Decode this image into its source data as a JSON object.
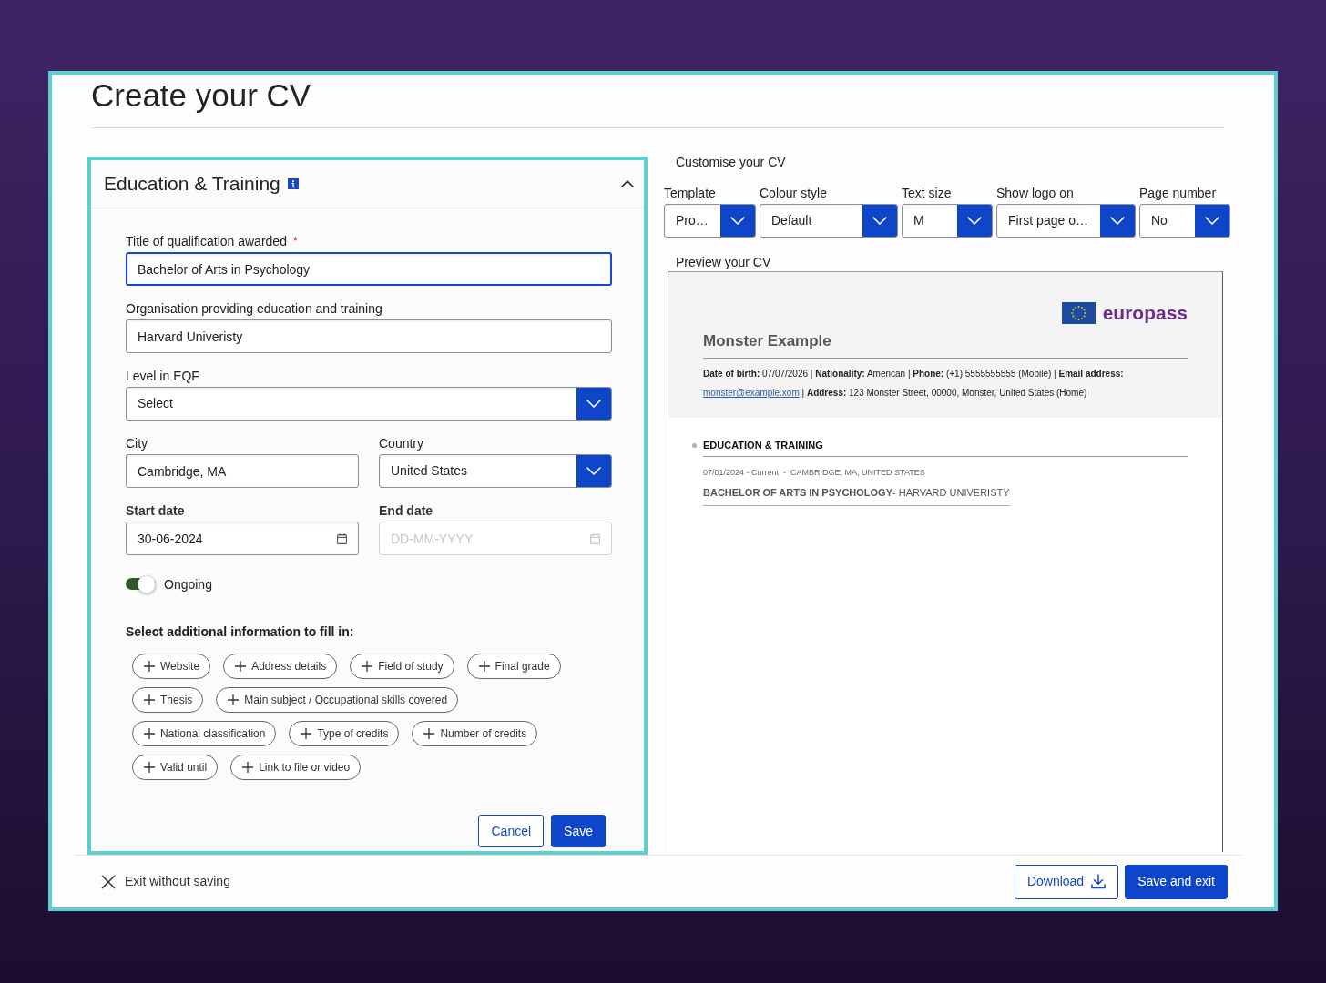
{
  "page": {
    "title": "Create your CV"
  },
  "editor": {
    "title": "Education & Training",
    "expanded": true,
    "rows": [
      [
        {
          "kind": "text",
          "label": "Title of qualification awarded",
          "required_mark": "*",
          "value": "Bachelor of Arts in Psychology",
          "focused": true
        }
      ],
      [
        {
          "kind": "text",
          "label": "Organisation providing education and training",
          "value": "Harvard Univeristy",
          "focused": false
        }
      ],
      [
        {
          "kind": "select",
          "label": "Level in EQF",
          "value": "Select"
        }
      ],
      [
        {
          "kind": "text",
          "label": "City",
          "value": "Cambridge, MA",
          "focused": false
        },
        {
          "kind": "select",
          "label": "Country",
          "value": "United States"
        }
      ],
      [
        {
          "kind": "date",
          "label": "Start date",
          "value": "30-06-2024",
          "disabled": false
        },
        {
          "kind": "date",
          "label": "End date",
          "placeholder": "DD-MM-YYYY",
          "disabled": true
        }
      ]
    ],
    "ongoing": {
      "label": "Ongoing",
      "on": true
    },
    "additional": {
      "heading": "Select additional information to fill in:",
      "rows": [
        [
          "Website",
          "Address details",
          "Field of study",
          "Final grade"
        ],
        [
          "Thesis",
          "Main subject / Occupational skills covered"
        ],
        [
          "National classification",
          "Type of credits",
          "Number of credits"
        ],
        [
          "Valid until",
          "Link to file or video"
        ]
      ]
    },
    "buttons": [
      {
        "kind": "secondary",
        "label": "Cancel"
      },
      {
        "kind": "primary",
        "label": "Save"
      }
    ]
  },
  "customise": {
    "heading": "Customise your CV",
    "options": [
      {
        "label": "Template",
        "value": "Pro…"
      },
      {
        "label": "Colour style",
        "value": "Default"
      },
      {
        "label": "Text size",
        "value": "M"
      },
      {
        "label": "Show logo on",
        "value": "First page o…"
      },
      {
        "label": "Page number",
        "value": "No"
      }
    ]
  },
  "preview": {
    "heading": "Preview your CV",
    "logo_text": "europass",
    "name": "Monster Example",
    "contact": {
      "before_link": "**Date of birth:** 07/07/2026 | **Nationality:** American | **Phone:** (+1) 5555555555 (Mobile) | **Email address:**",
      "link": "monster@example.xom",
      "after_link": "| **Address:** 123 Monster Street, 00000, Monster, United States (Home)"
    },
    "sections": [
      {
        "title": "EDUCATION & TRAINING",
        "entries": [
          {
            "meta": "07/01/2024 - Current  -  CAMBRIDGE, MA, UNITED STATES",
            "title": "**BACHELOR OF ARTS IN PSYCHOLOGY**- HARVARD UNIVERISTY"
          }
        ]
      }
    ]
  },
  "footer": {
    "exit": "Exit without saving",
    "buttons": [
      {
        "kind": "download",
        "label": "Download"
      },
      {
        "kind": "primary",
        "label": "Save and exit"
      }
    ]
  }
}
